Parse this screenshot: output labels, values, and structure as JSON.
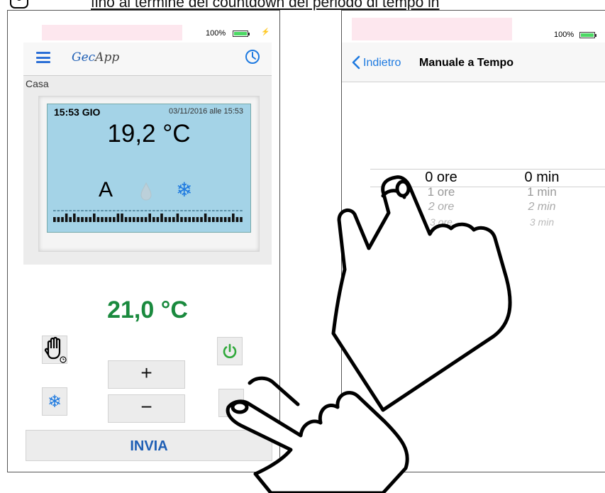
{
  "caption": {
    "text": "fino al termine del countdown del periodo di tempo in"
  },
  "left_screen": {
    "status": {
      "battery_text": "100%"
    },
    "header": {
      "app_name": "GecApp",
      "app_name_prefix": "Gec",
      "app_name_suffix": "App"
    },
    "device": {
      "room_label": "Casa",
      "time": "15:53 GIO",
      "date": "03/11/2016 alle 15:53",
      "temperature": "19,2 °C",
      "mode": "A"
    },
    "setpoint": "21,0 °C",
    "controls": {
      "plus": "+",
      "minus": "−",
      "send": "INVIA"
    }
  },
  "right_screen": {
    "status": {
      "battery_text": "100%"
    },
    "nav": {
      "back_label": "Indietro",
      "title": "Manuale a Tempo"
    },
    "picker": {
      "hours": [
        "0 ore",
        "1 ore",
        "2 ore",
        "3 ore"
      ],
      "minutes": [
        "0 min",
        "1 min",
        "2 min",
        "3 min"
      ]
    }
  },
  "colors": {
    "accent_blue": "#1e7ae0",
    "power_green": "#2fa83a",
    "setpoint_green": "#1a8a3e",
    "lcd_blue": "#a4d3e7"
  }
}
